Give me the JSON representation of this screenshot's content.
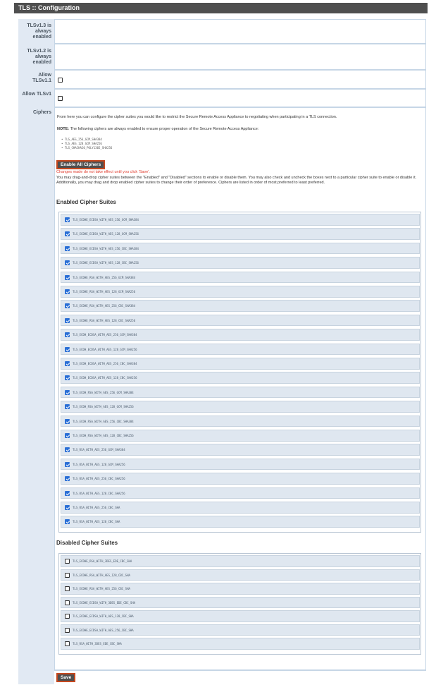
{
  "page": {
    "title": "TLS :: Configuration"
  },
  "rows": {
    "tls13": {
      "label": "TLSv1.3 is always enabled"
    },
    "tls12": {
      "label": "TLSv1.2 is always enabled"
    },
    "tls11": {
      "label": "Allow TLSv1.1",
      "checked": false
    },
    "tls1": {
      "label": "Allow TLSv1",
      "checked": false
    },
    "ciphers": {
      "label": "Ciphers"
    }
  },
  "ciphers": {
    "intro": "From here you can configure the cipher suites you would like to restrict the Secure Remote Access Appliance to negotiating when participating in a TLS connection.",
    "note_label": "NOTE:",
    "note_text": "The following ciphers are always enabled to ensure proper operation of the Secure Remote Access Appliance:",
    "always": [
      "TLS_AES_256_GCM_SHA384",
      "TLS_AES_128_GCM_SHA256",
      "TLS_CHACHA20_POLY1305_SHA256"
    ],
    "enable_all_label": "Enable All Ciphers",
    "warning": "Changes made do not take effect until you click 'Save'.",
    "instructions": "You may drag-and-drop cipher suites between the \"Enabled\" and \"Disabled\" sections to enable or disable them. You may also check and uncheck the boxes next to a particular cipher suite to enable or disable it. Additionally, you may drag and drop enabled cipher suites to change their order of preference. Ciphers are listed in order of most preferred to least preferred.",
    "enabled_heading": "Enabled Cipher Suites",
    "disabled_heading": "Disabled Cipher Suites",
    "enabled": [
      "TLS_ECDHE_ECDSA_WITH_AES_256_GCM_SHA384",
      "TLS_ECDHE_ECDSA_WITH_AES_128_GCM_SHA256",
      "TLS_ECDHE_ECDSA_WITH_AES_256_CBC_SHA384",
      "TLS_ECDHE_ECDSA_WITH_AES_128_CBC_SHA256",
      "TLS_ECDHE_RSA_WITH_AES_256_GCM_SHA384",
      "TLS_ECDHE_RSA_WITH_AES_128_GCM_SHA256",
      "TLS_ECDHE_RSA_WITH_AES_256_CBC_SHA384",
      "TLS_ECDHE_RSA_WITH_AES_128_CBC_SHA256",
      "TLS_ECDH_ECDSA_WITH_AES_256_GCM_SHA384",
      "TLS_ECDH_ECDSA_WITH_AES_128_GCM_SHA256",
      "TLS_ECDH_ECDSA_WITH_AES_256_CBC_SHA384",
      "TLS_ECDH_ECDSA_WITH_AES_128_CBC_SHA256",
      "TLS_ECDH_RSA_WITH_AES_256_GCM_SHA384",
      "TLS_ECDH_RSA_WITH_AES_128_GCM_SHA256",
      "TLS_ECDH_RSA_WITH_AES_256_CBC_SHA384",
      "TLS_ECDH_RSA_WITH_AES_128_CBC_SHA256",
      "TLS_RSA_WITH_AES_256_GCM_SHA384",
      "TLS_RSA_WITH_AES_128_GCM_SHA256",
      "TLS_RSA_WITH_AES_256_CBC_SHA256",
      "TLS_RSA_WITH_AES_128_CBC_SHA256",
      "TLS_RSA_WITH_AES_256_CBC_SHA",
      "TLS_RSA_WITH_AES_128_CBC_SHA"
    ],
    "disabled": [
      "TLS_ECDHE_RSA_WITH_3DES_EDE_CBC_SHA",
      "TLS_ECDHE_RSA_WITH_AES_128_CBC_SHA",
      "TLS_ECDHE_RSA_WITH_AES_256_CBC_SHA",
      "TLS_ECDHE_ECDSA_WITH_3DES_EDE_CBC_SHA",
      "TLS_ECDHE_ECDSA_WITH_AES_128_CBC_SHA",
      "TLS_ECDHE_ECDSA_WITH_AES_256_CBC_SHA",
      "TLS_RSA_WITH_3DES_EDE_CBC_SHA"
    ]
  },
  "save_label": "Save"
}
